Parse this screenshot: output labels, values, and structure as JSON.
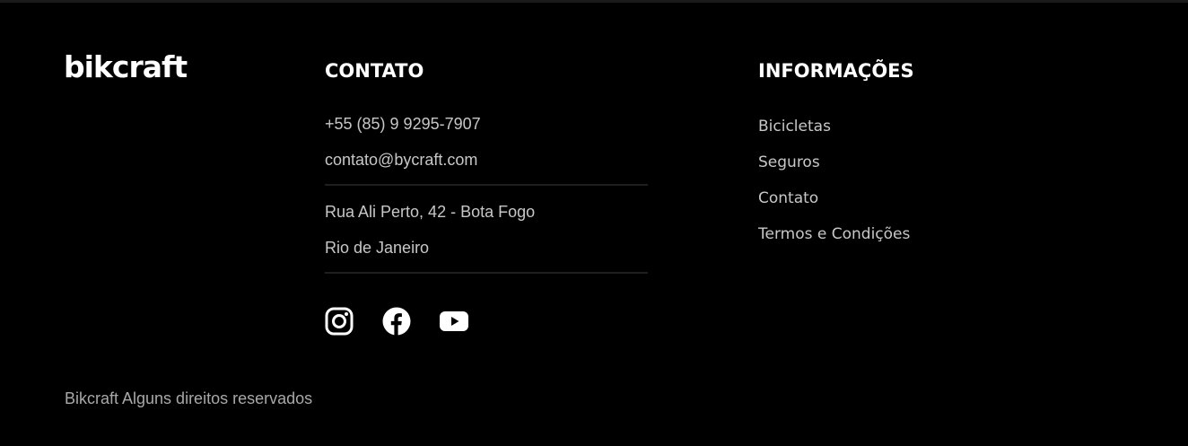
{
  "brand": {
    "logo_text": "bikcraft"
  },
  "contato": {
    "title": "CONTATO",
    "phone": "+55 (85) 9 9295-7907",
    "email": "contato@bycraft.com",
    "address_line1": "Rua Ali Perto, 42 - Bota Fogo",
    "address_line2": "Rio de Janeiro",
    "social": [
      {
        "name": "instagram",
        "icon": "instagram-icon"
      },
      {
        "name": "facebook",
        "icon": "facebook-icon"
      },
      {
        "name": "youtube",
        "icon": "youtube-icon"
      }
    ]
  },
  "informacoes": {
    "title": "INFORMAÇÕES",
    "links": [
      {
        "label": "Bicicletas"
      },
      {
        "label": "Seguros"
      },
      {
        "label": "Contato"
      },
      {
        "label": "Termos e Condições"
      }
    ]
  },
  "copyright": "Bikcraft Alguns direitos reservados",
  "colors": {
    "background": "#000000",
    "title": "#ffffff",
    "text": "#c7c7c7",
    "muted": "#a8a8a8",
    "divider": "#1f1f1f"
  }
}
